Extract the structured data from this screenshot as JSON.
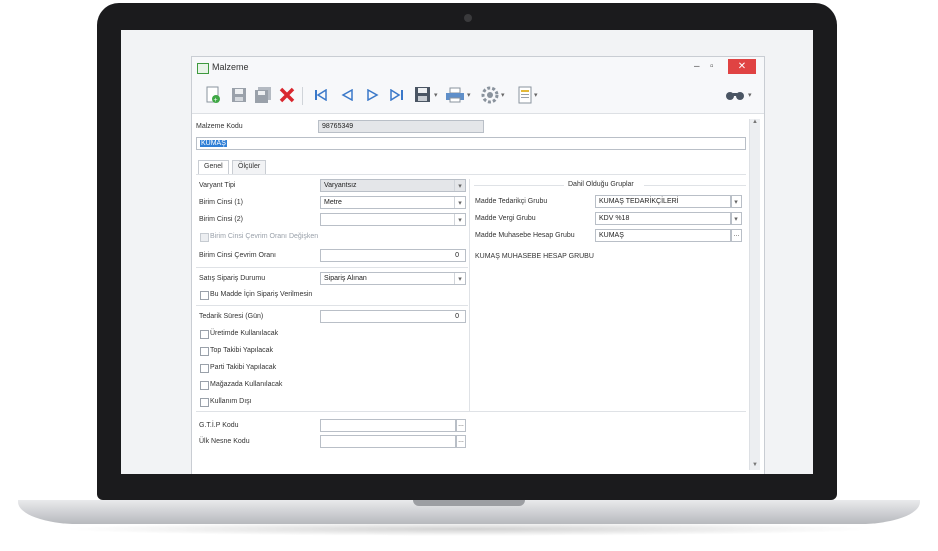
{
  "window": {
    "title": "Malzeme",
    "minimize": "–",
    "maximize": "▫",
    "close": "✕"
  },
  "toolbar": {
    "icons": [
      "new-icon",
      "save-icon",
      "save-all-icon",
      "delete-icon",
      "first-icon",
      "previous-icon",
      "next-icon",
      "last-icon",
      "save-dropdown-icon",
      "print-icon",
      "settings-icon",
      "report-icon",
      "search-icon"
    ],
    "dropdown_caret": "▾"
  },
  "header": {
    "code_label": "Malzeme Kodu",
    "code_value": "98765349",
    "name_value": "KUMAŞ"
  },
  "tabs": [
    "Genel",
    "Ölçüler"
  ],
  "left": {
    "variant_type_label": "Varyant Tipi",
    "variant_type_value": "Varyantsız",
    "unit1_label": "Birim Cinsi (1)",
    "unit1_value": "Metre",
    "unit2_label": "Birim Cinsi (2)",
    "unit2_value": "",
    "unit_change_label": "Birim Cinsi Çevrim Oranı Değişken",
    "unit_rate_label": "Birim Cinsi Çevrim Oranı",
    "unit_rate_value": "0",
    "sales_status_label": "Satış Sipariş Durumu",
    "sales_status_value": "Sipariş Alınan",
    "no_order_label": "Bu Madde İçin Sipariş Verilmesin",
    "lead_time_label": "Tedarik Süresi (Gün)",
    "lead_time_value": "0",
    "checks": [
      "Üretimde Kullanılacak",
      "Top Takibi Yapılacak",
      "Parti Takibi Yapılacak",
      "Mağazada Kullanılacak",
      "Kullanım Dışı"
    ],
    "gtip_label": "G.T.İ.P Kodu",
    "origin_label": "Ülk Nesne Kodu"
  },
  "right": {
    "group_title": "Dahil Olduğu Gruplar",
    "supplier_label": "Madde Tedarikçi Grubu",
    "supplier_value": "KUMAŞ TEDARİKÇİLERİ",
    "tax_label": "Madde Vergi Grubu",
    "tax_value": "KDV %18",
    "account_label": "Madde Muhasebe Hesap Grubu",
    "account_value": "KUMAŞ",
    "account_desc": "KUMAŞ MUHASEBE HESAP GRUBU"
  },
  "colors": {
    "accent": "#2f7fd6",
    "close": "#e04343",
    "delete": "#d9272e",
    "nav": "#3a78c9"
  }
}
